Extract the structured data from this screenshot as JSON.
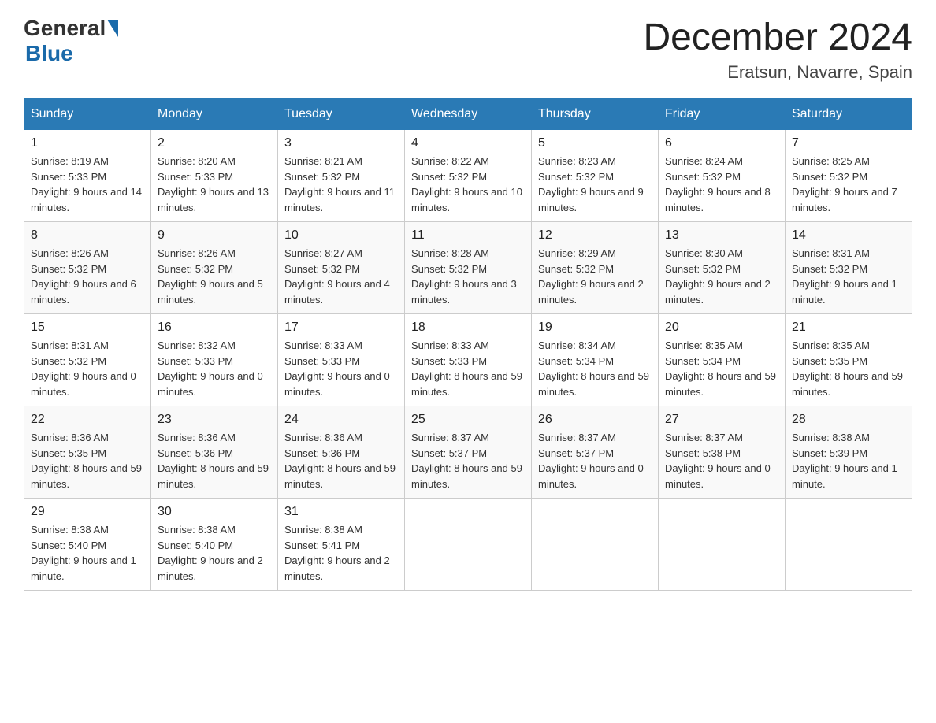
{
  "header": {
    "logo_general": "General",
    "logo_blue": "Blue",
    "month_year": "December 2024",
    "location": "Eratsun, Navarre, Spain"
  },
  "days_of_week": [
    "Sunday",
    "Monday",
    "Tuesday",
    "Wednesday",
    "Thursday",
    "Friday",
    "Saturday"
  ],
  "weeks": [
    [
      {
        "day": "1",
        "sunrise": "8:19 AM",
        "sunset": "5:33 PM",
        "daylight": "9 hours and 14 minutes."
      },
      {
        "day": "2",
        "sunrise": "8:20 AM",
        "sunset": "5:33 PM",
        "daylight": "9 hours and 13 minutes."
      },
      {
        "day": "3",
        "sunrise": "8:21 AM",
        "sunset": "5:32 PM",
        "daylight": "9 hours and 11 minutes."
      },
      {
        "day": "4",
        "sunrise": "8:22 AM",
        "sunset": "5:32 PM",
        "daylight": "9 hours and 10 minutes."
      },
      {
        "day": "5",
        "sunrise": "8:23 AM",
        "sunset": "5:32 PM",
        "daylight": "9 hours and 9 minutes."
      },
      {
        "day": "6",
        "sunrise": "8:24 AM",
        "sunset": "5:32 PM",
        "daylight": "9 hours and 8 minutes."
      },
      {
        "day": "7",
        "sunrise": "8:25 AM",
        "sunset": "5:32 PM",
        "daylight": "9 hours and 7 minutes."
      }
    ],
    [
      {
        "day": "8",
        "sunrise": "8:26 AM",
        "sunset": "5:32 PM",
        "daylight": "9 hours and 6 minutes."
      },
      {
        "day": "9",
        "sunrise": "8:26 AM",
        "sunset": "5:32 PM",
        "daylight": "9 hours and 5 minutes."
      },
      {
        "day": "10",
        "sunrise": "8:27 AM",
        "sunset": "5:32 PM",
        "daylight": "9 hours and 4 minutes."
      },
      {
        "day": "11",
        "sunrise": "8:28 AM",
        "sunset": "5:32 PM",
        "daylight": "9 hours and 3 minutes."
      },
      {
        "day": "12",
        "sunrise": "8:29 AM",
        "sunset": "5:32 PM",
        "daylight": "9 hours and 2 minutes."
      },
      {
        "day": "13",
        "sunrise": "8:30 AM",
        "sunset": "5:32 PM",
        "daylight": "9 hours and 2 minutes."
      },
      {
        "day": "14",
        "sunrise": "8:31 AM",
        "sunset": "5:32 PM",
        "daylight": "9 hours and 1 minute."
      }
    ],
    [
      {
        "day": "15",
        "sunrise": "8:31 AM",
        "sunset": "5:32 PM",
        "daylight": "9 hours and 0 minutes."
      },
      {
        "day": "16",
        "sunrise": "8:32 AM",
        "sunset": "5:33 PM",
        "daylight": "9 hours and 0 minutes."
      },
      {
        "day": "17",
        "sunrise": "8:33 AM",
        "sunset": "5:33 PM",
        "daylight": "9 hours and 0 minutes."
      },
      {
        "day": "18",
        "sunrise": "8:33 AM",
        "sunset": "5:33 PM",
        "daylight": "8 hours and 59 minutes."
      },
      {
        "day": "19",
        "sunrise": "8:34 AM",
        "sunset": "5:34 PM",
        "daylight": "8 hours and 59 minutes."
      },
      {
        "day": "20",
        "sunrise": "8:35 AM",
        "sunset": "5:34 PM",
        "daylight": "8 hours and 59 minutes."
      },
      {
        "day": "21",
        "sunrise": "8:35 AM",
        "sunset": "5:35 PM",
        "daylight": "8 hours and 59 minutes."
      }
    ],
    [
      {
        "day": "22",
        "sunrise": "8:36 AM",
        "sunset": "5:35 PM",
        "daylight": "8 hours and 59 minutes."
      },
      {
        "day": "23",
        "sunrise": "8:36 AM",
        "sunset": "5:36 PM",
        "daylight": "8 hours and 59 minutes."
      },
      {
        "day": "24",
        "sunrise": "8:36 AM",
        "sunset": "5:36 PM",
        "daylight": "8 hours and 59 minutes."
      },
      {
        "day": "25",
        "sunrise": "8:37 AM",
        "sunset": "5:37 PM",
        "daylight": "8 hours and 59 minutes."
      },
      {
        "day": "26",
        "sunrise": "8:37 AM",
        "sunset": "5:37 PM",
        "daylight": "9 hours and 0 minutes."
      },
      {
        "day": "27",
        "sunrise": "8:37 AM",
        "sunset": "5:38 PM",
        "daylight": "9 hours and 0 minutes."
      },
      {
        "day": "28",
        "sunrise": "8:38 AM",
        "sunset": "5:39 PM",
        "daylight": "9 hours and 1 minute."
      }
    ],
    [
      {
        "day": "29",
        "sunrise": "8:38 AM",
        "sunset": "5:40 PM",
        "daylight": "9 hours and 1 minute."
      },
      {
        "day": "30",
        "sunrise": "8:38 AM",
        "sunset": "5:40 PM",
        "daylight": "9 hours and 2 minutes."
      },
      {
        "day": "31",
        "sunrise": "8:38 AM",
        "sunset": "5:41 PM",
        "daylight": "9 hours and 2 minutes."
      },
      null,
      null,
      null,
      null
    ]
  ],
  "labels": {
    "sunrise": "Sunrise:",
    "sunset": "Sunset:",
    "daylight": "Daylight:"
  }
}
